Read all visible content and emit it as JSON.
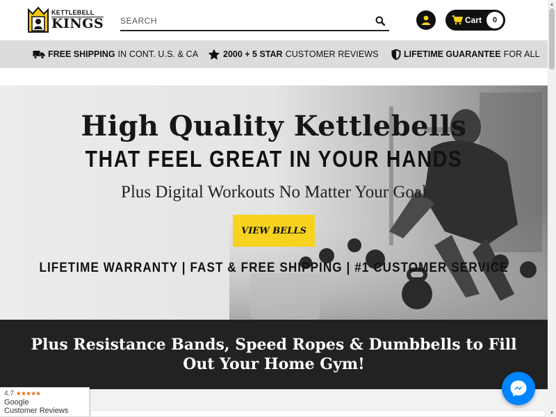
{
  "header": {
    "logo_small": "KETTLEBELL",
    "logo_big": "KINGS",
    "search_placeholder": "SEARCH",
    "cart_label": "Cart",
    "cart_count": "0",
    "icons": {
      "search": "search-icon",
      "account": "user-icon",
      "cart": "shopping-cart-icon"
    }
  },
  "benefits": [
    {
      "icon": "truck-icon",
      "bold": "FREE SHIPPING",
      "rest": "IN CONT. U.S. & CA"
    },
    {
      "icon": "star-icon",
      "bold": "2000 + 5 STAR",
      "rest": "CUSTOMER REVIEWS"
    },
    {
      "icon": "shield-icon",
      "bold": "LIFETIME GUARANTEE",
      "rest": "FOR ALL"
    }
  ],
  "hero": {
    "title": "High Quality Kettlebells",
    "subtitle": "THAT FEEL GREAT IN YOUR HANDS",
    "tagline": "Plus Digital Workouts No Matter Your Goal",
    "button": "VIEW BELLS",
    "features": "LIFETIME WARRANTY | FAST & FREE SHIPPING | #1 CUSTOMER SERVICE"
  },
  "band": {
    "text": "Plus Resistance Bands, Speed Ropes & Dumbbells to Fill Out Your Home Gym!"
  },
  "google_widget": {
    "rating": "4.7",
    "stars": "★★★★★",
    "name": "Google",
    "label": "Customer Reviews"
  },
  "colors": {
    "accent_yellow": "#f7d31f",
    "band_dark": "#222222",
    "messenger_blue": "#0084ff",
    "benefit_bar": "#dcdcdc"
  }
}
